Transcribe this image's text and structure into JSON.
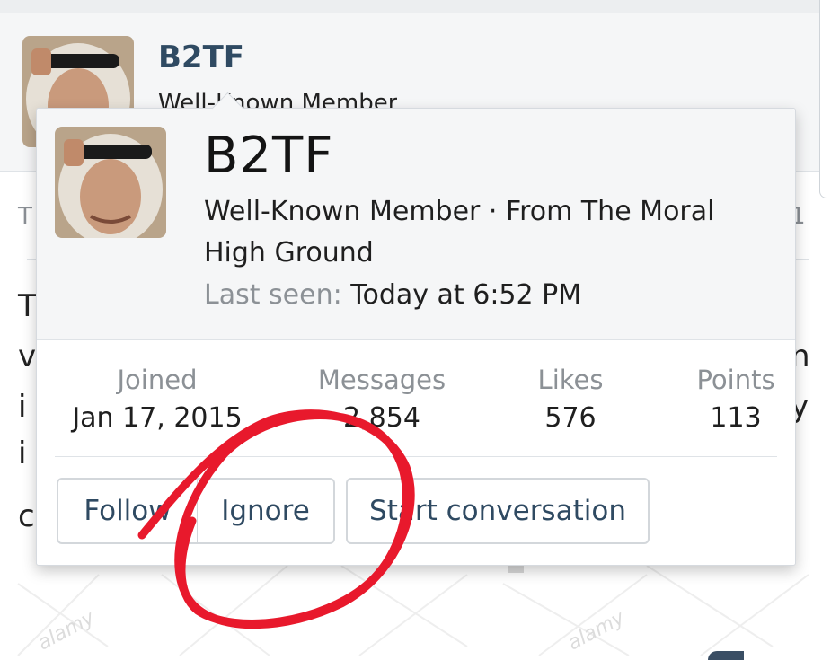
{
  "background": {
    "username": "B2TF",
    "title_peek": "Well-Known Member",
    "edge_left_letters": [
      "T",
      "v",
      "i",
      "i",
      "c"
    ],
    "edge_right_letters": [
      "n",
      "y"
    ],
    "meta_left": "T",
    "meta_right": "1",
    "watermark_text": "alamy"
  },
  "card": {
    "username": "B2TF",
    "user_title": "Well-Known Member · From The Moral High Ground",
    "last_seen_label": "Last seen:",
    "last_seen_value": "Today at 6:52 PM",
    "stats": [
      {
        "label": "Joined",
        "value": "Jan 17, 2015"
      },
      {
        "label": "Messages",
        "value": "2,854"
      },
      {
        "label": "Likes",
        "value": "576"
      },
      {
        "label": "Points",
        "value": "113"
      }
    ],
    "buttons": {
      "follow": "Follow",
      "ignore": "Ignore",
      "conversation": "Start conversation"
    }
  },
  "colors": {
    "link": "#2f4a62",
    "header_bg": "#f5f6f7",
    "annotation": "#e8192c"
  },
  "icons": [
    "avatar"
  ]
}
